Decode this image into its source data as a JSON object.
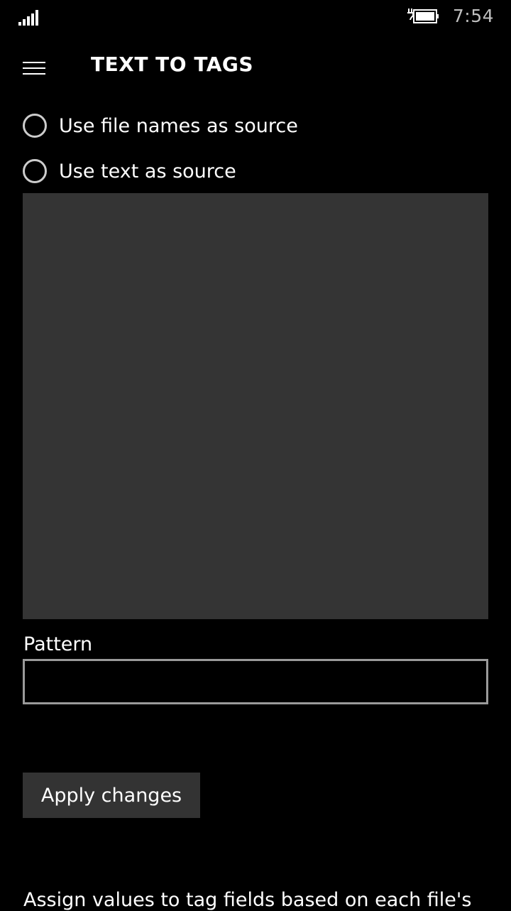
{
  "status_bar": {
    "time": "7:54",
    "signal_icon": "signal-strength-icon",
    "battery_icon": "battery-charging-icon"
  },
  "header": {
    "menu_icon": "hamburger-menu-icon",
    "title": "TEXT TO TAGS"
  },
  "source_options": [
    {
      "label": "Use file names as source",
      "selected": false
    },
    {
      "label": "Use text as source",
      "selected": false
    }
  ],
  "text_area": {
    "value": ""
  },
  "pattern": {
    "label": "Pattern",
    "value": ""
  },
  "apply_button": {
    "label": "Apply changes"
  },
  "description": {
    "text": "Assign values to tag fields based on each file's"
  },
  "colors": {
    "background": "#000000",
    "text_area_background": "#343434",
    "button_background": "#333333",
    "input_border": "#9a9a9a",
    "clock": "#bfbfbf"
  }
}
